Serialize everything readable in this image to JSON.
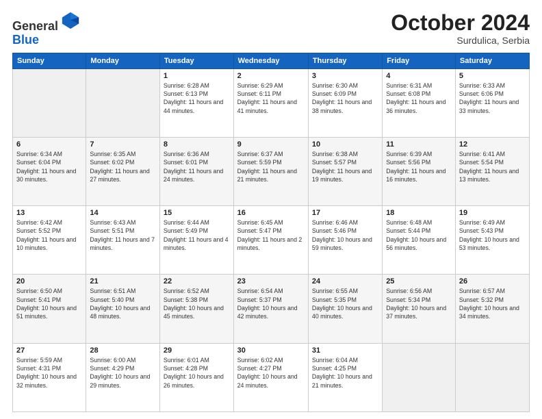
{
  "header": {
    "logo_line1": "General",
    "logo_line2": "Blue",
    "month": "October 2024",
    "location": "Surdulica, Serbia"
  },
  "weekdays": [
    "Sunday",
    "Monday",
    "Tuesday",
    "Wednesday",
    "Thursday",
    "Friday",
    "Saturday"
  ],
  "weeks": [
    [
      {
        "day": "",
        "info": ""
      },
      {
        "day": "",
        "info": ""
      },
      {
        "day": "1",
        "info": "Sunrise: 6:28 AM\nSunset: 6:13 PM\nDaylight: 11 hours and 44 minutes."
      },
      {
        "day": "2",
        "info": "Sunrise: 6:29 AM\nSunset: 6:11 PM\nDaylight: 11 hours and 41 minutes."
      },
      {
        "day": "3",
        "info": "Sunrise: 6:30 AM\nSunset: 6:09 PM\nDaylight: 11 hours and 38 minutes."
      },
      {
        "day": "4",
        "info": "Sunrise: 6:31 AM\nSunset: 6:08 PM\nDaylight: 11 hours and 36 minutes."
      },
      {
        "day": "5",
        "info": "Sunrise: 6:33 AM\nSunset: 6:06 PM\nDaylight: 11 hours and 33 minutes."
      }
    ],
    [
      {
        "day": "6",
        "info": "Sunrise: 6:34 AM\nSunset: 6:04 PM\nDaylight: 11 hours and 30 minutes."
      },
      {
        "day": "7",
        "info": "Sunrise: 6:35 AM\nSunset: 6:02 PM\nDaylight: 11 hours and 27 minutes."
      },
      {
        "day": "8",
        "info": "Sunrise: 6:36 AM\nSunset: 6:01 PM\nDaylight: 11 hours and 24 minutes."
      },
      {
        "day": "9",
        "info": "Sunrise: 6:37 AM\nSunset: 5:59 PM\nDaylight: 11 hours and 21 minutes."
      },
      {
        "day": "10",
        "info": "Sunrise: 6:38 AM\nSunset: 5:57 PM\nDaylight: 11 hours and 19 minutes."
      },
      {
        "day": "11",
        "info": "Sunrise: 6:39 AM\nSunset: 5:56 PM\nDaylight: 11 hours and 16 minutes."
      },
      {
        "day": "12",
        "info": "Sunrise: 6:41 AM\nSunset: 5:54 PM\nDaylight: 11 hours and 13 minutes."
      }
    ],
    [
      {
        "day": "13",
        "info": "Sunrise: 6:42 AM\nSunset: 5:52 PM\nDaylight: 11 hours and 10 minutes."
      },
      {
        "day": "14",
        "info": "Sunrise: 6:43 AM\nSunset: 5:51 PM\nDaylight: 11 hours and 7 minutes."
      },
      {
        "day": "15",
        "info": "Sunrise: 6:44 AM\nSunset: 5:49 PM\nDaylight: 11 hours and 4 minutes."
      },
      {
        "day": "16",
        "info": "Sunrise: 6:45 AM\nSunset: 5:47 PM\nDaylight: 11 hours and 2 minutes."
      },
      {
        "day": "17",
        "info": "Sunrise: 6:46 AM\nSunset: 5:46 PM\nDaylight: 10 hours and 59 minutes."
      },
      {
        "day": "18",
        "info": "Sunrise: 6:48 AM\nSunset: 5:44 PM\nDaylight: 10 hours and 56 minutes."
      },
      {
        "day": "19",
        "info": "Sunrise: 6:49 AM\nSunset: 5:43 PM\nDaylight: 10 hours and 53 minutes."
      }
    ],
    [
      {
        "day": "20",
        "info": "Sunrise: 6:50 AM\nSunset: 5:41 PM\nDaylight: 10 hours and 51 minutes."
      },
      {
        "day": "21",
        "info": "Sunrise: 6:51 AM\nSunset: 5:40 PM\nDaylight: 10 hours and 48 minutes."
      },
      {
        "day": "22",
        "info": "Sunrise: 6:52 AM\nSunset: 5:38 PM\nDaylight: 10 hours and 45 minutes."
      },
      {
        "day": "23",
        "info": "Sunrise: 6:54 AM\nSunset: 5:37 PM\nDaylight: 10 hours and 42 minutes."
      },
      {
        "day": "24",
        "info": "Sunrise: 6:55 AM\nSunset: 5:35 PM\nDaylight: 10 hours and 40 minutes."
      },
      {
        "day": "25",
        "info": "Sunrise: 6:56 AM\nSunset: 5:34 PM\nDaylight: 10 hours and 37 minutes."
      },
      {
        "day": "26",
        "info": "Sunrise: 6:57 AM\nSunset: 5:32 PM\nDaylight: 10 hours and 34 minutes."
      }
    ],
    [
      {
        "day": "27",
        "info": "Sunrise: 5:59 AM\nSunset: 4:31 PM\nDaylight: 10 hours and 32 minutes."
      },
      {
        "day": "28",
        "info": "Sunrise: 6:00 AM\nSunset: 4:29 PM\nDaylight: 10 hours and 29 minutes."
      },
      {
        "day": "29",
        "info": "Sunrise: 6:01 AM\nSunset: 4:28 PM\nDaylight: 10 hours and 26 minutes."
      },
      {
        "day": "30",
        "info": "Sunrise: 6:02 AM\nSunset: 4:27 PM\nDaylight: 10 hours and 24 minutes."
      },
      {
        "day": "31",
        "info": "Sunrise: 6:04 AM\nSunset: 4:25 PM\nDaylight: 10 hours and 21 minutes."
      },
      {
        "day": "",
        "info": ""
      },
      {
        "day": "",
        "info": ""
      }
    ]
  ]
}
